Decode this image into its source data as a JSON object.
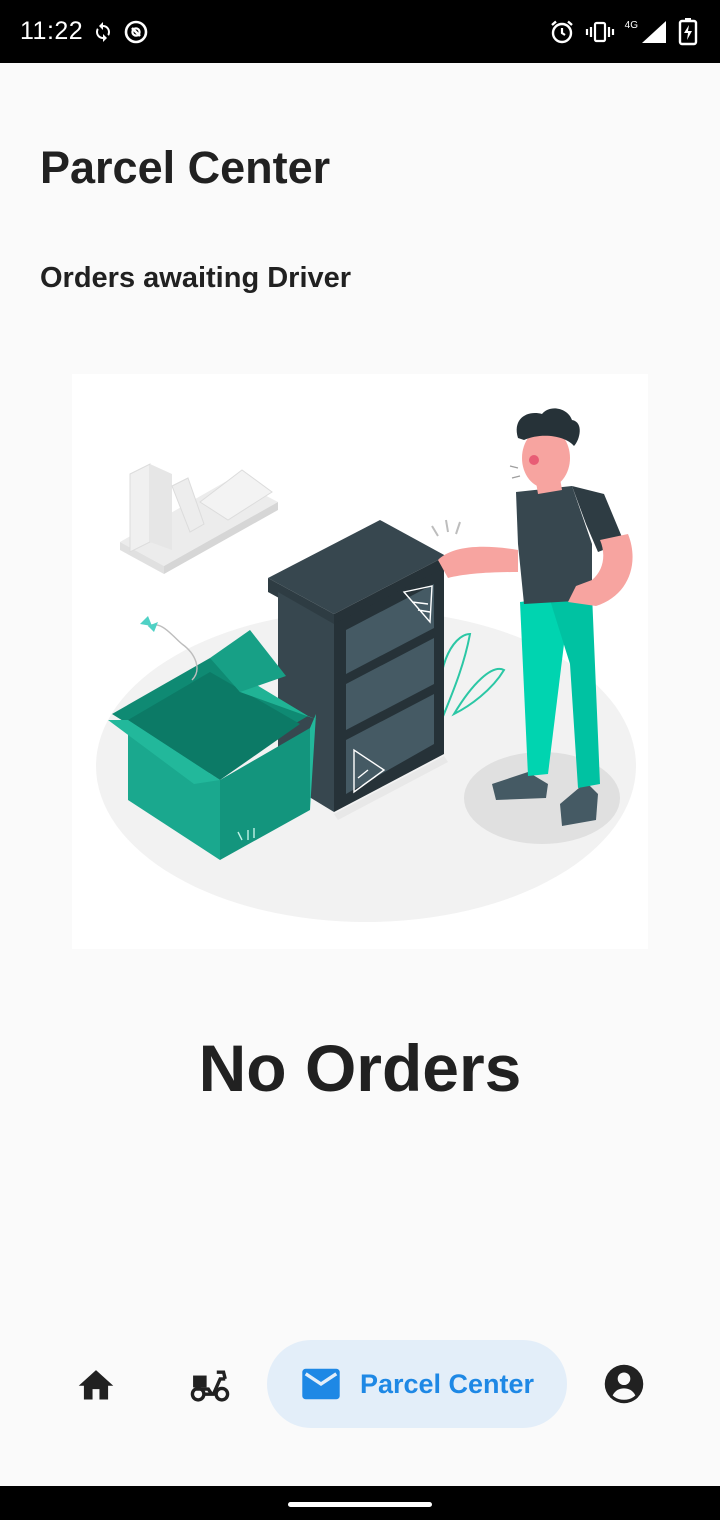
{
  "status_bar": {
    "time": "11:22",
    "network": "4G",
    "icons": [
      "sync-icon",
      "do-not-disturb-icon",
      "alarm-icon",
      "vibrate-icon",
      "signal-icon",
      "battery-charging-icon"
    ]
  },
  "header": {
    "title": "Parcel Center"
  },
  "section": {
    "title": "Orders awaiting Driver"
  },
  "empty_state": {
    "illustration": "empty-shelf-with-open-box-illustration",
    "message": "No Orders"
  },
  "bottom_nav": {
    "items": [
      {
        "icon": "home-icon",
        "label": ""
      },
      {
        "icon": "scooter-icon",
        "label": ""
      },
      {
        "icon": "mail-icon",
        "label": "Parcel Center",
        "active": true
      },
      {
        "icon": "account-circle-icon",
        "label": ""
      }
    ]
  },
  "colors": {
    "accent": "#1e88e5",
    "active_pill": "#e3eef9",
    "box_teal": "#1aa88e",
    "cabinet": "#37474f",
    "pants": "#00d4b0",
    "skin": "#f7a4a0"
  }
}
